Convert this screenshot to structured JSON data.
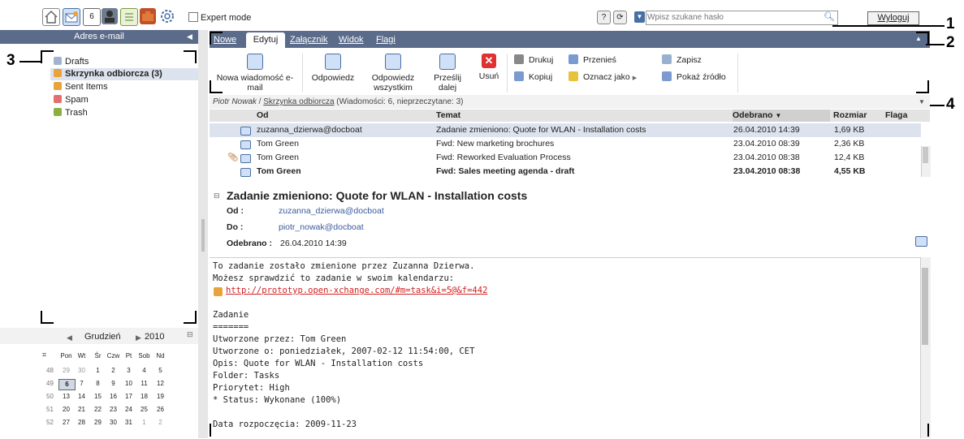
{
  "toolbar": {
    "icons": [
      "home-icon",
      "mail-icon",
      "calendar-icon",
      "contacts-icon",
      "tasks-icon",
      "infostore-icon",
      "settings-icon"
    ],
    "expert_mode": "Expert mode",
    "search_placeholder": "Wpisz szukane hasło",
    "logout": "Wyloguj"
  },
  "sidebar": {
    "title": "Adres e-mail",
    "folders": [
      {
        "label": "Drafts",
        "bold": false
      },
      {
        "label": "Skrzynka odbiorcza (3)",
        "bold": true
      },
      {
        "label": "Sent Items",
        "bold": false
      },
      {
        "label": "Spam",
        "bold": false
      },
      {
        "label": "Trash",
        "bold": false
      }
    ]
  },
  "calendar": {
    "month": "Grudzień",
    "year": "2010",
    "days": [
      "Pon",
      "Wt",
      "Śr",
      "Czw",
      "Pt",
      "Sob",
      "Nd"
    ],
    "weeks": [
      {
        "wk": "48",
        "d": [
          "29",
          "30",
          "1",
          "2",
          "3",
          "4",
          "5"
        ]
      },
      {
        "wk": "49",
        "d": [
          "6",
          "7",
          "8",
          "9",
          "10",
          "11",
          "12"
        ]
      },
      {
        "wk": "50",
        "d": [
          "13",
          "14",
          "15",
          "16",
          "17",
          "18",
          "19"
        ]
      },
      {
        "wk": "51",
        "d": [
          "20",
          "21",
          "22",
          "23",
          "24",
          "25",
          "26"
        ]
      },
      {
        "wk": "52",
        "d": [
          "27",
          "28",
          "29",
          "30",
          "31",
          "1",
          "2"
        ]
      }
    ]
  },
  "tabs": [
    "Nowe",
    "Edytuj",
    "Załącznik",
    "Widok",
    "Flagi"
  ],
  "ribbon": {
    "big": [
      "Nowa wiadomość e-mail",
      "Odpowiedz",
      "Odpowiedz wszystkim",
      "Prześlij dalej",
      "Usuń"
    ],
    "small": [
      "Drukuj",
      "Kopiuj",
      "Przenieś",
      "Oznacz jako",
      "Zapisz",
      "Pokaż źródło"
    ]
  },
  "breadcrumb": {
    "user": "Piotr Nowak",
    "folder": "Skrzynka odbiorcza",
    "info": "(Wiadomości: 6, nieprzeczytane: 3)"
  },
  "list": {
    "columns": [
      "Od",
      "Temat",
      "Odebrano",
      "Rozmiar",
      "Flaga"
    ],
    "rows": [
      {
        "from": "zuzanna_dzierwa@docboat",
        "subject": "Zadanie zmieniono: Quote for WLAN - Installation costs",
        "date": "26.04.2010 14:39",
        "size": "1,69 KB",
        "bold": false,
        "selected": true,
        "attach": false
      },
      {
        "from": "Tom Green",
        "subject": "Fwd: New marketing brochures",
        "date": "23.04.2010 08:39",
        "size": "2,36 KB",
        "bold": false,
        "selected": false,
        "attach": false
      },
      {
        "from": "Tom Green",
        "subject": "Fwd: Reworked Evaluation Process",
        "date": "23.04.2010 08:38",
        "size": "12,4 KB",
        "bold": false,
        "selected": false,
        "attach": true
      },
      {
        "from": "Tom Green",
        "subject": "Fwd: Sales meeting agenda - draft",
        "date": "23.04.2010 08:38",
        "size": "4,55 KB",
        "bold": true,
        "selected": false,
        "attach": false
      }
    ]
  },
  "message": {
    "title": "Zadanie zmieniono: Quote for WLAN - Installation costs",
    "from_label": "Od :",
    "from": "zuzanna_dzierwa@docboat",
    "to_label": "Do :",
    "to": "piotr_nowak@docboat",
    "date_label": "Odebrano :",
    "date": "26.04.2010 14:39",
    "body": [
      "To zadanie zostało zmienione przez Zuzanna Dzierwa.",
      "Możesz sprawdzić to zadanie w swoim kalendarzu:",
      "http://prototyp.open-xchange.com/#m=task&i=5@&f=442",
      "",
      "Zadanie",
      "=======",
      "Utworzone przez: Tom Green",
      "Utworzone o: poniedziałek, 2007-02-12 11:54:00, CET",
      "Opis: Quote for WLAN - Installation costs",
      "Folder: Tasks",
      "Priorytet: High",
      "* Status: Wykonane (100%)",
      "",
      "Data rozpoczęcia: 2009-11-23"
    ]
  },
  "callouts": [
    "1",
    "2",
    "3",
    "4"
  ]
}
